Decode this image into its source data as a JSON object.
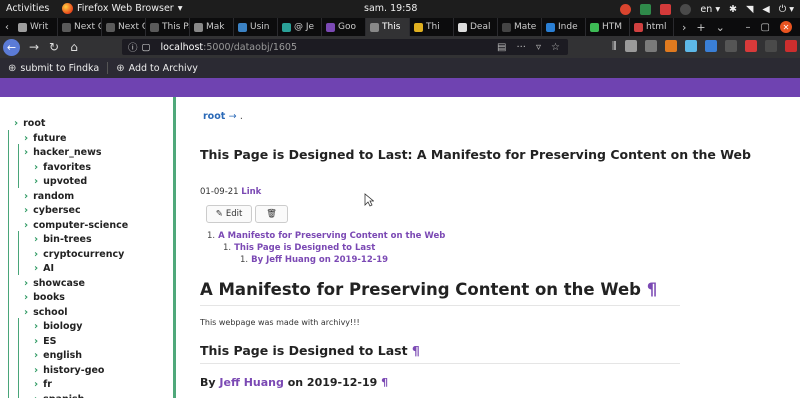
{
  "os_bar": {
    "activities": "Activities",
    "app_name": "Firefox Web Browser",
    "clock": "sam. 19:58",
    "language": "en"
  },
  "tabs": [
    {
      "label": "Writ",
      "color": "#9e9e9e"
    },
    {
      "label": "Next Ge",
      "color": "#5a5a5a"
    },
    {
      "label": "Next Ge",
      "color": "#5a5a5a"
    },
    {
      "label": "This Pag",
      "color": "#5a5a5a"
    },
    {
      "label": "Mak",
      "color": "#888888"
    },
    {
      "label": "Usin",
      "color": "#3b82c4"
    },
    {
      "label": "@ Je",
      "color": "#2aa198"
    },
    {
      "label": "Goo",
      "color": "#7b49b4"
    },
    {
      "label": "This",
      "color": "#888888",
      "active": true
    },
    {
      "label": "Thi",
      "color": "#e0b020"
    },
    {
      "label": "Deal",
      "color": "#dddddd"
    },
    {
      "label": "Mate",
      "color": "#444444"
    },
    {
      "label": "Inde",
      "color": "#2a7fd4"
    },
    {
      "label": "HTM",
      "color": "#3dbb55"
    },
    {
      "label": "html",
      "color": "#d04040"
    }
  ],
  "address": {
    "host": "localhost",
    "path": ":5000/dataobj/1605"
  },
  "bookmarks": [
    {
      "label": "submit to Findka"
    },
    {
      "label": "Add to Archivy"
    }
  ],
  "sidebar": {
    "items": [
      {
        "label": "root"
      },
      {
        "label": "future"
      },
      {
        "label": "hacker_news"
      },
      {
        "label": "favorites"
      },
      {
        "label": "upvoted"
      },
      {
        "label": "random"
      },
      {
        "label": "cybersec"
      },
      {
        "label": "computer-science"
      },
      {
        "label": "bin-trees"
      },
      {
        "label": "cryptocurrency"
      },
      {
        "label": "AI"
      },
      {
        "label": "showcase"
      },
      {
        "label": "books"
      },
      {
        "label": "school"
      },
      {
        "label": "biology"
      },
      {
        "label": "ES"
      },
      {
        "label": "english"
      },
      {
        "label": "history-geo"
      },
      {
        "label": "fr"
      },
      {
        "label": "spanish"
      }
    ]
  },
  "main": {
    "breadcrumb_root": "root",
    "breadcrumb_arrow": "→",
    "breadcrumb_current": ".",
    "page_title": "This Page is Designed to Last: A Manifesto for Preserving Content on the Web",
    "date": "01-09-21",
    "link_label": "Link",
    "edit_label": "Edit",
    "toc": [
      {
        "num": "1.",
        "text": "A Manifesto for Preserving Content on the Web"
      },
      {
        "num": "1.",
        "text": "This Page is Designed to Last"
      },
      {
        "num": "1.",
        "text": "By Jeff Huang on 2019-12-19"
      }
    ],
    "heading1": "A Manifesto for Preserving Content on the Web",
    "pilcrow": "¶",
    "paragraph": "This webpage was made with archivy!!!",
    "heading2": "This Page is Designed to Last",
    "byline_prefix": "By",
    "byline_author": "Jeff Huang",
    "byline_suffix": "on 2019-12-19"
  }
}
